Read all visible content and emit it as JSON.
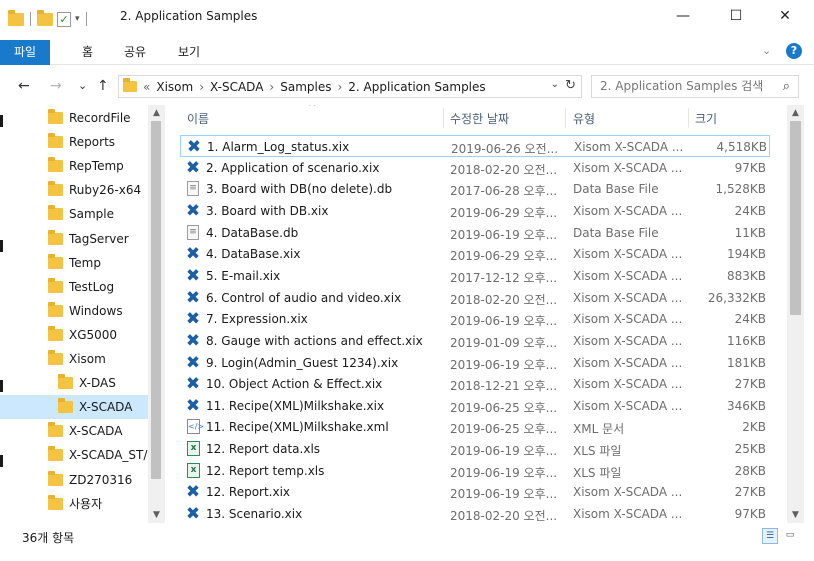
{
  "window": {
    "title": "2. Application Samples",
    "minimize_glyph": "—",
    "maximize_glyph": "☐",
    "close_glyph": "✕"
  },
  "ribbon": {
    "tabs": [
      "파일",
      "홈",
      "공유",
      "보기"
    ],
    "help_glyph": "?"
  },
  "navigation": {
    "back_glyph": "←",
    "forward_glyph": "→",
    "recent_glyph": "⌄",
    "up_glyph": "↑",
    "address_overflow": "«",
    "breadcrumbs": [
      "Xisom",
      "X-SCADA",
      "Samples",
      "2. Application Samples"
    ],
    "search_placeholder": "2. Application Samples 검색"
  },
  "sidebar": {
    "items": [
      {
        "label": "RecordFile"
      },
      {
        "label": "Reports"
      },
      {
        "label": "RepTemp"
      },
      {
        "label": "Ruby26-x64"
      },
      {
        "label": "Sample"
      },
      {
        "label": "TagServer"
      },
      {
        "label": "Temp"
      },
      {
        "label": "TestLog"
      },
      {
        "label": "Windows"
      },
      {
        "label": "XG5000"
      },
      {
        "label": "Xisom"
      },
      {
        "label": "X-DAS"
      },
      {
        "label": "X-SCADA"
      },
      {
        "label": "X-SCADA"
      },
      {
        "label": "X-SCADA_ST/"
      },
      {
        "label": "ZD270316"
      },
      {
        "label": "사용자"
      }
    ]
  },
  "file_list": {
    "columns": {
      "name": "이름",
      "date": "수정한 날짜",
      "type": "유형",
      "size": "크기"
    },
    "rows": [
      {
        "name": "1. Alarm_Log_status.xix",
        "date": "2019-06-26 오전...",
        "type": "Xisom X-SCADA ...",
        "size": "4,518KB",
        "icon": "xix"
      },
      {
        "name": "2. Application of scenario.xix",
        "date": "2018-02-20 오전...",
        "type": "Xisom X-SCADA ...",
        "size": "97KB",
        "icon": "xix"
      },
      {
        "name": "3. Board with DB(no delete).db",
        "date": "2017-06-28 오후...",
        "type": "Data Base File",
        "size": "1,528KB",
        "icon": "db"
      },
      {
        "name": "3. Board with DB.xix",
        "date": "2019-06-29 오후...",
        "type": "Xisom X-SCADA ...",
        "size": "24KB",
        "icon": "xix"
      },
      {
        "name": "4. DataBase.db",
        "date": "2019-06-19 오후...",
        "type": "Data Base File",
        "size": "11KB",
        "icon": "db"
      },
      {
        "name": "4. DataBase.xix",
        "date": "2019-06-29 오후...",
        "type": "Xisom X-SCADA ...",
        "size": "194KB",
        "icon": "xix"
      },
      {
        "name": "5. E-mail.xix",
        "date": "2017-12-12 오후...",
        "type": "Xisom X-SCADA ...",
        "size": "883KB",
        "icon": "xix"
      },
      {
        "name": "6. Control of audio and video.xix",
        "date": "2018-02-20 오전...",
        "type": "Xisom X-SCADA ...",
        "size": "26,332KB",
        "icon": "xix"
      },
      {
        "name": "7. Expression.xix",
        "date": "2019-06-19 오후...",
        "type": "Xisom X-SCADA ...",
        "size": "24KB",
        "icon": "xix"
      },
      {
        "name": "8. Gauge with actions and effect.xix",
        "date": "2019-01-09 오후...",
        "type": "Xisom X-SCADA ...",
        "size": "116KB",
        "icon": "xix"
      },
      {
        "name": "9. Login(Admin_Guest 1234).xix",
        "date": "2019-06-19 오후...",
        "type": "Xisom X-SCADA ...",
        "size": "181KB",
        "icon": "xix"
      },
      {
        "name": "10. Object Action & Effect.xix",
        "date": "2018-12-21 오후...",
        "type": "Xisom X-SCADA ...",
        "size": "27KB",
        "icon": "xix"
      },
      {
        "name": "11. Recipe(XML)Milkshake.xix",
        "date": "2019-06-25 오후...",
        "type": "Xisom X-SCADA ...",
        "size": "346KB",
        "icon": "xix"
      },
      {
        "name": "11. Recipe(XML)Milkshake.xml",
        "date": "2019-06-25 오후...",
        "type": "XML 문서",
        "size": "2KB",
        "icon": "xml"
      },
      {
        "name": "12. Report data.xls",
        "date": "2019-06-19 오후...",
        "type": "XLS 파일",
        "size": "25KB",
        "icon": "xls"
      },
      {
        "name": "12. Report temp.xls",
        "date": "2019-06-19 오후...",
        "type": "XLS 파일",
        "size": "28KB",
        "icon": "xls"
      },
      {
        "name": "12. Report.xix",
        "date": "2019-06-19 오후...",
        "type": "Xisom X-SCADA ...",
        "size": "27KB",
        "icon": "xix"
      },
      {
        "name": "13. Scenario.xix",
        "date": "2018-02-20 오전...",
        "type": "Xisom X-SCADA ...",
        "size": "97KB",
        "icon": "xix"
      }
    ]
  },
  "status": {
    "item_count": "36개 항목"
  },
  "colors": {
    "accent": "#1979ca",
    "selection": "#cce8ff",
    "folder": "#f5c342",
    "xix_icon": "#1d5fa5"
  }
}
